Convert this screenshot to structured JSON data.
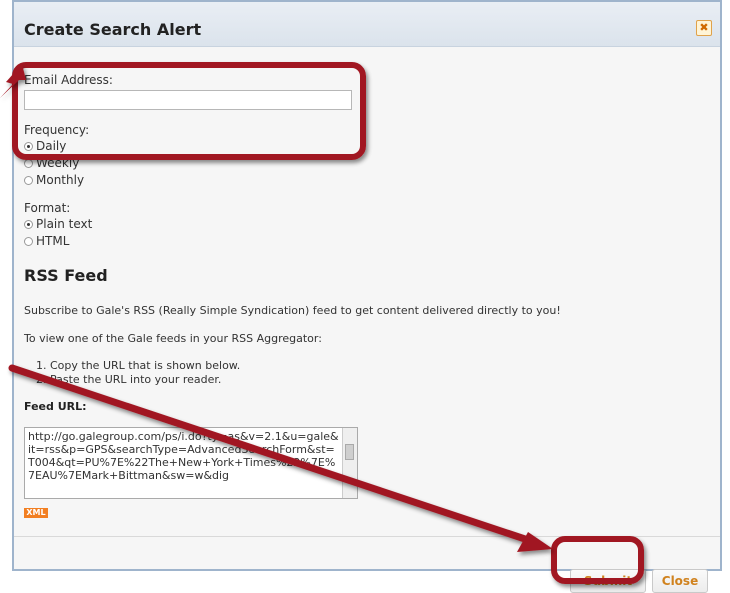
{
  "dialog": {
    "title": "Create Search Alert",
    "close_icon": "close-icon"
  },
  "form": {
    "email_label": "Email Address:",
    "email_value": "",
    "frequency_label": "Frequency:",
    "frequency_options": [
      {
        "label": "Daily",
        "selected": true
      },
      {
        "label": "Weekly",
        "selected": false
      },
      {
        "label": "Monthly",
        "selected": false
      }
    ],
    "format_label": "Format:",
    "format_options": [
      {
        "label": "Plain text",
        "selected": true
      },
      {
        "label": "HTML",
        "selected": false
      }
    ]
  },
  "rss": {
    "heading": "RSS Feed",
    "intro": "Subscribe to Gale's RSS (Really Simple Syndication) feed to get content delivered directly to you!",
    "instructions_lead": "To view one of the Gale feeds in your RSS Aggregator:",
    "steps": [
      "1.  Copy the URL that is shown below.",
      "2.  Paste the URL into your reader."
    ],
    "feed_label": "Feed URL:",
    "feed_url": "http://go.galegroup.com/ps/i.do?ty=as&v=2.1&u=gale&it=rss&p=GPS&searchType=AdvancedSearchForm&st=T004&qt=PU%7E%22The+New+York+Times%22%7E%7EAU%7EMark+Bittman&sw=w&dig",
    "xml_badge": "XML"
  },
  "footer": {
    "submit_label": "Submit",
    "close_label": "Close"
  },
  "colors": {
    "annotation": "#a11722",
    "button_text": "#d0821e",
    "xml_badge": "#f27f22"
  }
}
